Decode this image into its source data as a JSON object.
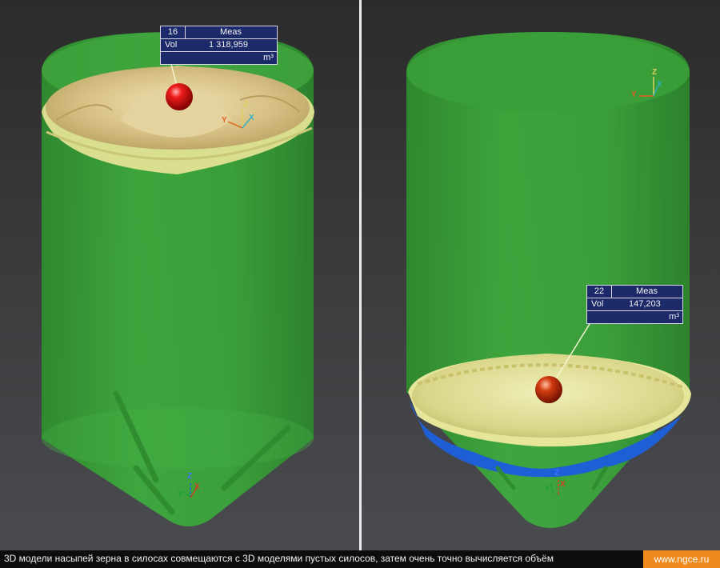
{
  "colors": {
    "silo_green": "#39a83a",
    "grain_yellow": "#e8e7a0",
    "grain_tan": "#d9c383",
    "empty_silo_blue": "#1f5fd6",
    "marker_red": "#d40e0e",
    "tag_bg": "#1c2a6a",
    "brand_orange": "#f08a1d"
  },
  "left_view": {
    "measure": {
      "id": "16",
      "header": "Meas",
      "param": "Vol",
      "value": "1 318,959",
      "unit": "m³"
    },
    "axes": {
      "z": "Z",
      "x": "X",
      "y": "Y"
    },
    "bottom_axes": {
      "z": "Z",
      "x": "X",
      "y": "Y"
    }
  },
  "right_view": {
    "measure": {
      "id": "22",
      "header": "Meas",
      "param": "Vol",
      "value": "147,203",
      "unit": "m³"
    },
    "axes": {
      "z": "Z",
      "x": "X",
      "y": "Y"
    },
    "bottom_axes": {
      "z": "Z",
      "x": "X",
      "y": "Y"
    }
  },
  "caption": {
    "text": "3D модели насыпей зерна в силосах совмещаются с 3D моделями пустых силосов, затем очень точно вычисляется объём",
    "site": "www.ngce.ru"
  }
}
